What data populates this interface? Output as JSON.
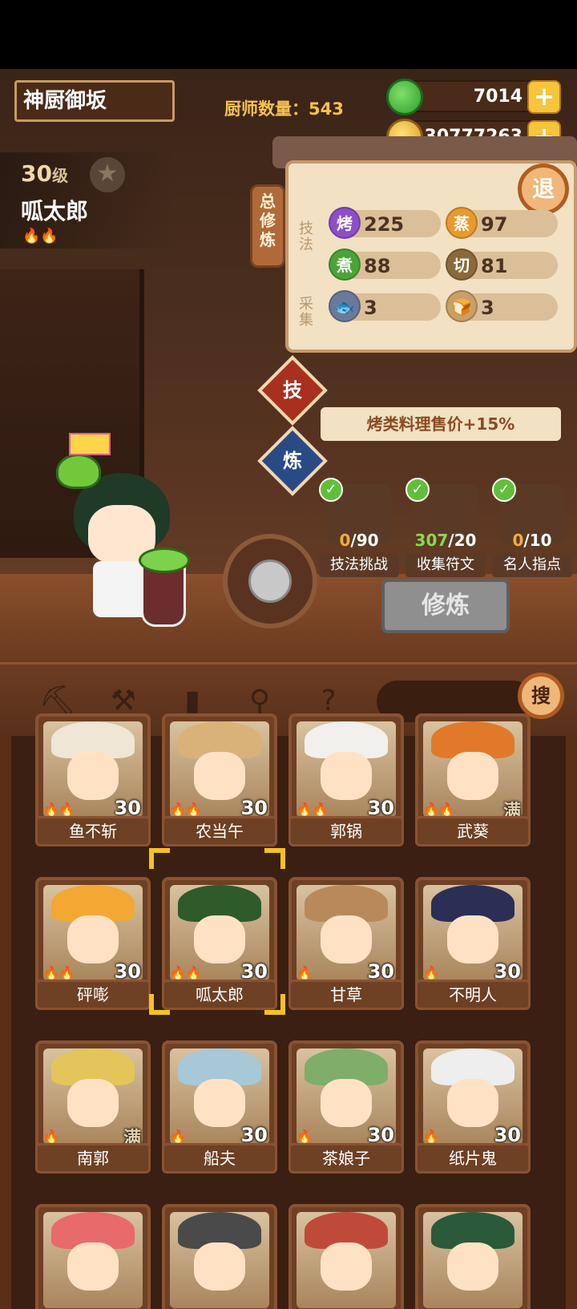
{
  "header": {
    "location": "神厨御坂",
    "chef_count_label": "厨师数量：543",
    "jade": "7014",
    "gold": "30777263",
    "plus_label": "+"
  },
  "chef": {
    "level": "30",
    "level_suffix": "级",
    "name": "呱太郎"
  },
  "panel": {
    "side_tab": "总修炼",
    "skill_group": "技法",
    "collect_group": "采集",
    "exit": "退",
    "skills": [
      {
        "badge": "烤",
        "value": "225",
        "color": "#8b4fc7"
      },
      {
        "badge": "蒸",
        "value": "97",
        "color": "#e89a2e"
      },
      {
        "badge": "煮",
        "value": "88",
        "color": "#4aa538"
      },
      {
        "badge": "切",
        "value": "81",
        "color": "#8a6a3a"
      }
    ],
    "collect": [
      {
        "icon": "fish-icon",
        "value": "3"
      },
      {
        "icon": "bread-icon",
        "value": "3"
      }
    ]
  },
  "tabs": {
    "skill": "技",
    "refine": "炼"
  },
  "bonus": "烤类料理售价+15%",
  "tasks": [
    {
      "done": "0",
      "total": "/90",
      "label": "技法挑战"
    },
    {
      "done": "307",
      "total": "/20",
      "label": "收集符文"
    },
    {
      "done": "0",
      "total": "/10",
      "label": "名人指点"
    }
  ],
  "train_button": "修炼",
  "toolbar": {
    "search_label": "搜",
    "tools": [
      "shovel-icon",
      "spade-icon",
      "jar-icon",
      "map-pin-icon",
      "map-question-icon"
    ]
  },
  "chefs": [
    {
      "name": "鱼不斩",
      "level": "30",
      "flames": "🔥🔥",
      "hat": "#efe6d6"
    },
    {
      "name": "农当午",
      "level": "30",
      "flames": "🔥🔥",
      "hat": "#d9b27a"
    },
    {
      "name": "郭锅",
      "level": "30",
      "flames": "🔥🔥",
      "hat": "#f2f0ec"
    },
    {
      "name": "武葵",
      "level": "满",
      "flames": "🔥🔥",
      "hat": "#e07a2a"
    },
    {
      "name": "砰嘭",
      "level": "30",
      "flames": "🔥🔥",
      "hat": "#f2a833"
    },
    {
      "name": "呱太郎",
      "level": "30",
      "flames": "🔥🔥",
      "hat": "#2f5a2a"
    },
    {
      "name": "甘草",
      "level": "30",
      "flames": "🔥",
      "hat": "#b88a5a"
    },
    {
      "name": "不明人",
      "level": "30",
      "flames": "🔥",
      "hat": "#2b2f55"
    },
    {
      "name": "南郭",
      "level": "满",
      "flames": "🔥",
      "hat": "#e4c55a"
    },
    {
      "name": "船夫",
      "level": "30",
      "flames": "🔥",
      "hat": "#a7c8d6"
    },
    {
      "name": "茶娘子",
      "level": "30",
      "flames": "🔥",
      "hat": "#7fae6a"
    },
    {
      "name": "纸片鬼",
      "level": "30",
      "flames": "🔥",
      "hat": "#eeeeee"
    },
    {
      "name": "",
      "level": "",
      "flames": "",
      "hat": "#e86a6a"
    },
    {
      "name": "",
      "level": "",
      "flames": "",
      "hat": "#4a4a4a"
    },
    {
      "name": "",
      "level": "",
      "flames": "",
      "hat": "#c04a3a"
    },
    {
      "name": "",
      "level": "",
      "flames": "",
      "hat": "#2a5a3a"
    }
  ]
}
